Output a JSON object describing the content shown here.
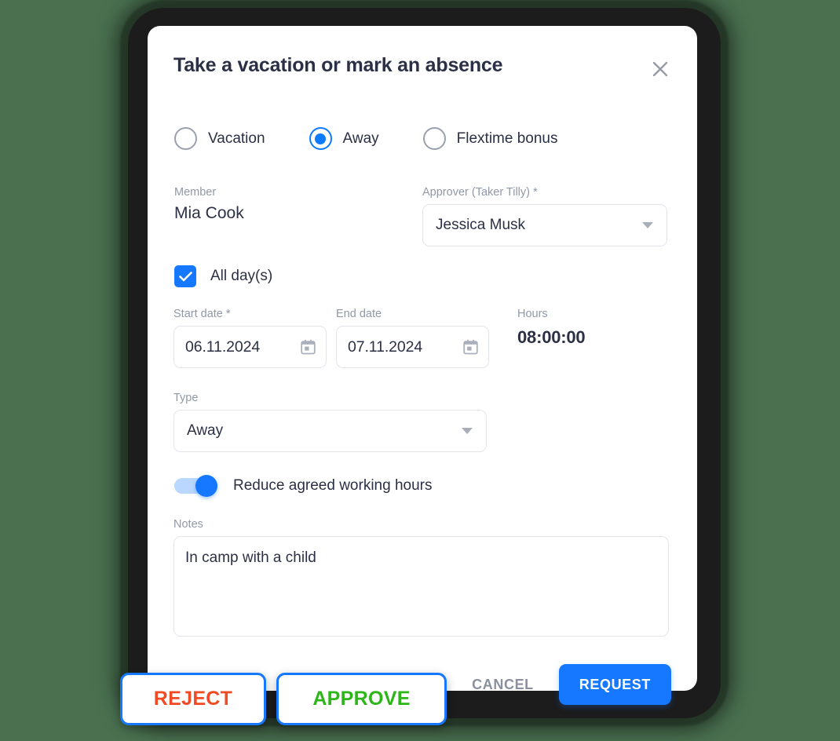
{
  "theme": {
    "background": "#4a7050",
    "accent_blue": "#1677ff",
    "card_background": "#ffffff",
    "text_dark": "#2b3044",
    "text_muted": "#9098a8",
    "reject_color": "#f04b25",
    "approve_color": "#2cb618"
  },
  "dialog": {
    "title": "Take a vacation or mark an absence",
    "close_icon": "close-icon",
    "absence_type_options": [
      {
        "label": "Vacation",
        "selected": false
      },
      {
        "label": "Away",
        "selected": true
      },
      {
        "label": "Flextime bonus",
        "selected": false
      }
    ],
    "member": {
      "label": "Member",
      "value": "Mia Cook"
    },
    "approver": {
      "label": "Approver (Taker Tilly) *",
      "value": "Jessica Musk",
      "caret_icon": "chevron-down-icon"
    },
    "all_days": {
      "label": "All day(s)",
      "checked": true,
      "check_icon": "check-icon"
    },
    "start_date": {
      "label": "Start date *",
      "value": "06.11.2024",
      "icon": "calendar-icon"
    },
    "end_date": {
      "label": "End date",
      "value": "07.11.2024",
      "icon": "calendar-icon"
    },
    "hours": {
      "label": "Hours",
      "value": "08:00:00"
    },
    "type": {
      "label": "Type",
      "value": "Away",
      "caret_icon": "chevron-down-icon"
    },
    "reduce_hours": {
      "label": "Reduce agreed working hours",
      "enabled": true
    },
    "notes": {
      "label": "Notes",
      "value": "In camp with a child",
      "placeholder": ""
    },
    "cancel_label": "CANCEL",
    "request_label": "REQUEST"
  },
  "floating_actions": {
    "reject_label": "REJECT",
    "approve_label": "APPROVE"
  }
}
